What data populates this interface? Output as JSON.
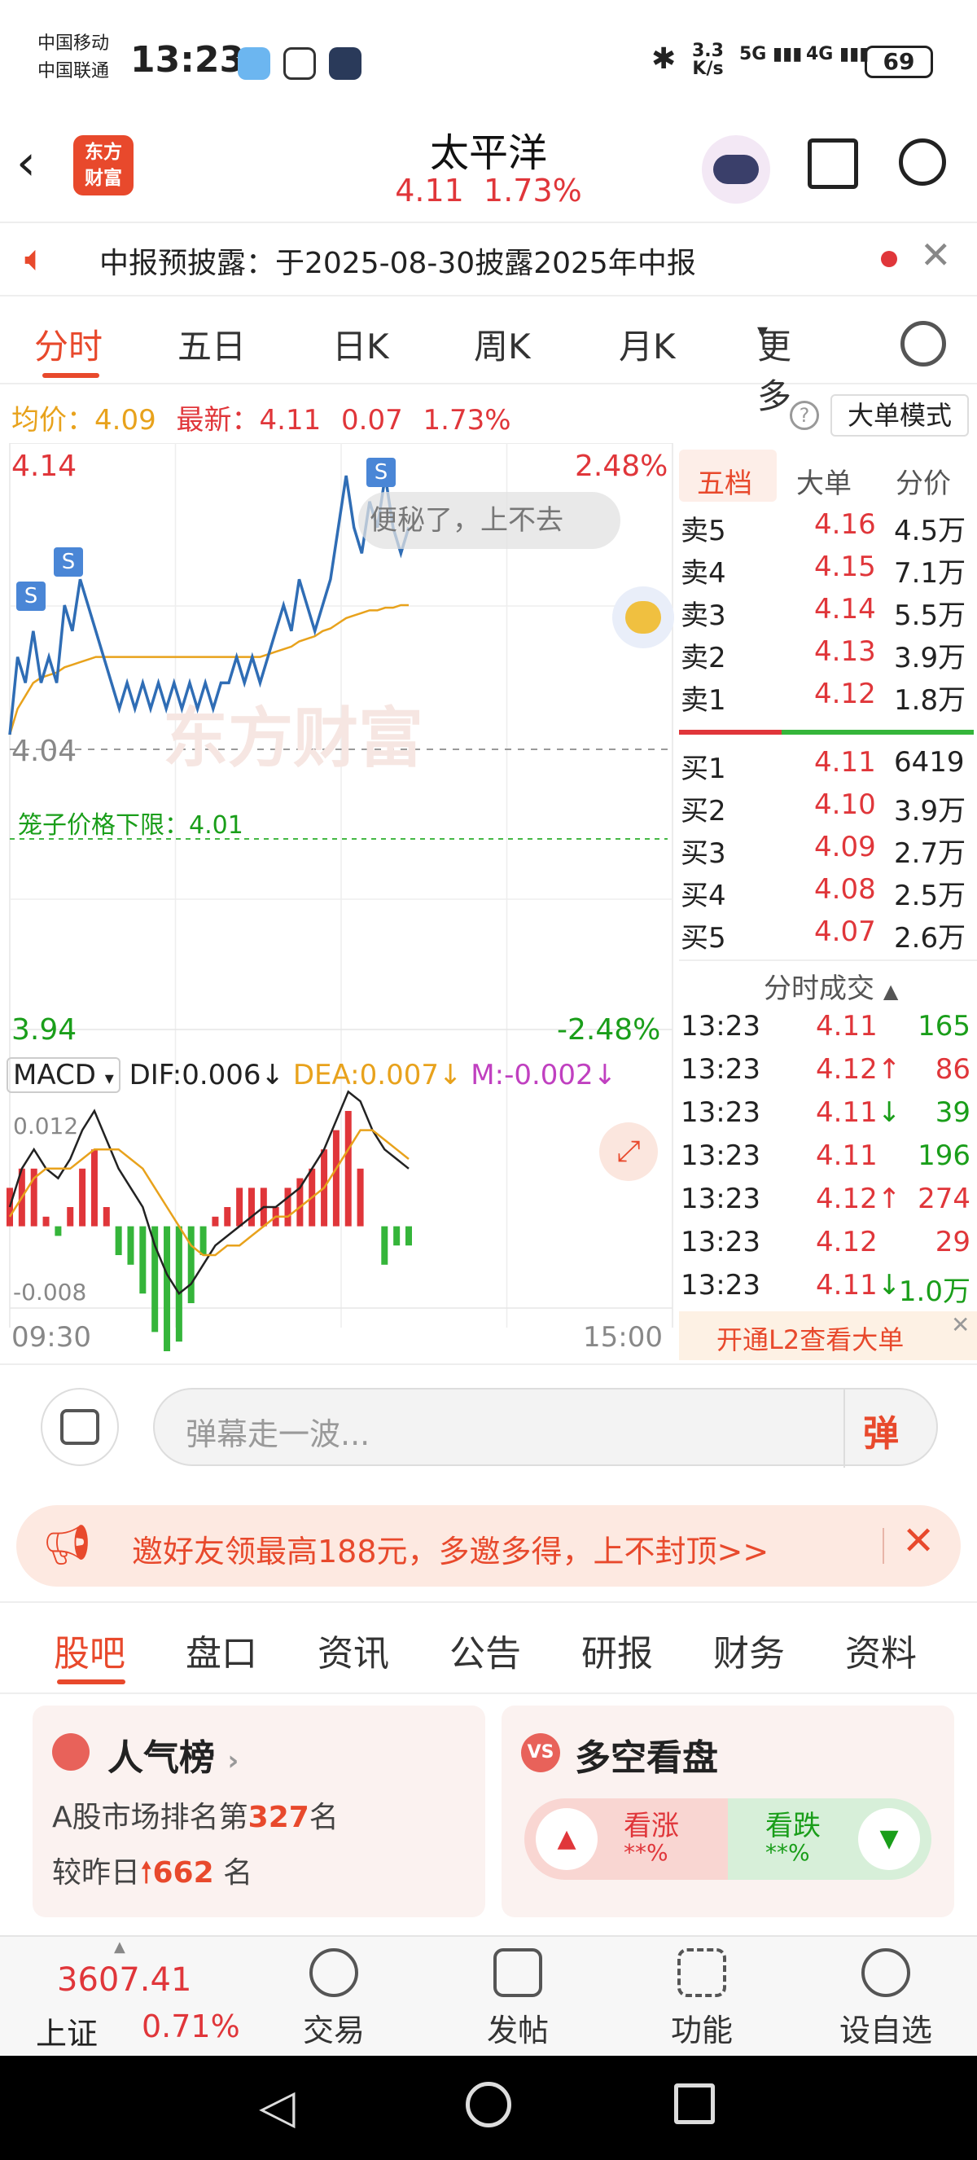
{
  "status": {
    "carrier1": "中国移动",
    "carrier2": "中国联通",
    "time": "13:23",
    "net_speed_top": "3.3",
    "net_speed_unit": "K/s",
    "net_5g": "5G",
    "net_4g": "4G",
    "battery": "69"
  },
  "header": {
    "brand_line1": "东方",
    "brand_line2": "财富",
    "stock_name": "太平洋",
    "stock_price": "4.11",
    "stock_change": "1.73%"
  },
  "notice": {
    "text": "中报预披露：于2025-08-30披露2025年中报"
  },
  "chart_tabs": [
    "分时",
    "五日",
    "日K",
    "周K",
    "月K",
    "更多"
  ],
  "summary": {
    "avg_label": "均价：",
    "avg_value": "4.09",
    "latest_label": "最新：",
    "latest_value": "4.11",
    "change_value": "0.07",
    "change_pct": "1.73%",
    "mode_button": "大单模式"
  },
  "chart_data": {
    "type": "line",
    "y_top": "4.14",
    "y_top_pct": "2.48%",
    "y_mid": "4.04",
    "y_bottom": "3.94",
    "y_bottom_pct": "-2.48%",
    "limit_label": "笼子价格下限：",
    "limit_value": "4.01",
    "x_start": "09:30",
    "x_end": "15:00",
    "watermark": "东方财富",
    "danmaku": "便秘了，上不去",
    "ylim": [
      3.94,
      4.14
    ],
    "price_series": [
      4.04,
      4.07,
      4.06,
      4.08,
      4.06,
      4.07,
      4.06,
      4.09,
      4.08,
      4.1,
      4.09,
      4.08,
      4.07,
      4.06,
      4.05,
      4.06,
      4.05,
      4.06,
      4.05,
      4.06,
      4.05,
      4.06,
      4.05,
      4.06,
      4.05,
      4.06,
      4.05,
      4.06,
      4.06,
      4.07,
      4.06,
      4.07,
      4.06,
      4.07,
      4.08,
      4.09,
      4.08,
      4.1,
      4.09,
      4.08,
      4.09,
      4.1,
      4.12,
      4.14,
      4.12,
      4.11,
      4.13,
      4.12,
      4.14,
      4.12,
      4.11,
      4.12
    ],
    "avg_series": [
      4.04,
      4.05,
      4.055,
      4.06,
      4.062,
      4.063,
      4.064,
      4.066,
      4.067,
      4.068,
      4.069,
      4.07,
      4.07,
      4.07,
      4.07,
      4.07,
      4.07,
      4.07,
      4.07,
      4.07,
      4.07,
      4.07,
      4.07,
      4.07,
      4.07,
      4.07,
      4.07,
      4.07,
      4.07,
      4.07,
      4.07,
      4.07,
      4.07,
      4.071,
      4.072,
      4.073,
      4.074,
      4.076,
      4.077,
      4.078,
      4.08,
      4.081,
      4.083,
      4.085,
      4.086,
      4.087,
      4.088,
      4.088,
      4.089,
      4.089,
      4.09,
      4.09
    ],
    "macd": {
      "label": "MACD",
      "dif_label": "DIF:",
      "dif": "0.006",
      "dea_label": "DEA:",
      "dea": "0.007",
      "m_label": "M:",
      "m": "-0.002",
      "top": "0.012",
      "bottom": "-0.008",
      "ylim": [
        -0.008,
        0.012
      ],
      "dif_series": [
        0.002,
        0.006,
        0.008,
        0.006,
        0.005,
        0.007,
        0.01,
        0.012,
        0.009,
        0.006,
        0.004,
        0.002,
        -0.002,
        -0.005,
        -0.007,
        -0.006,
        -0.004,
        -0.002,
        -0.001,
        0,
        0.001,
        0.002,
        0.002,
        0.003,
        0.004,
        0.006,
        0.008,
        0.011,
        0.014,
        0.013,
        0.01,
        0.008,
        0.007,
        0.006
      ],
      "dea_series": [
        0.001,
        0.003,
        0.005,
        0.006,
        0.006,
        0.006,
        0.007,
        0.008,
        0.008,
        0.008,
        0.007,
        0.006,
        0.004,
        0.002,
        0,
        -0.002,
        -0.003,
        -0.003,
        -0.002,
        -0.002,
        -0.001,
        0,
        0.001,
        0.001,
        0.002,
        0.003,
        0.004,
        0.006,
        0.008,
        0.01,
        0.01,
        0.009,
        0.008,
        0.007
      ],
      "hist": [
        0.004,
        0.006,
        0.006,
        0.001,
        -0.001,
        0.002,
        0.006,
        0.008,
        0.002,
        -0.003,
        -0.004,
        -0.007,
        -0.011,
        -0.013,
        -0.012,
        -0.008,
        -0.003,
        0.001,
        0.002,
        0.004,
        0.004,
        0.004,
        0.002,
        0.004,
        0.005,
        0.006,
        0.008,
        0.01,
        0.012,
        0.006,
        0,
        -0.004,
        -0.002,
        -0.002
      ]
    }
  },
  "orderbook": {
    "tabs": [
      "五档",
      "大单",
      "分价"
    ],
    "sells": [
      {
        "label": "卖5",
        "price": "4.16",
        "vol": "4.5万"
      },
      {
        "label": "卖4",
        "price": "4.15",
        "vol": "7.1万"
      },
      {
        "label": "卖3",
        "price": "4.14",
        "vol": "5.5万"
      },
      {
        "label": "卖2",
        "price": "4.13",
        "vol": "3.9万"
      },
      {
        "label": "卖1",
        "price": "4.12",
        "vol": "1.8万"
      }
    ],
    "buys": [
      {
        "label": "买1",
        "price": "4.11",
        "vol": "6419"
      },
      {
        "label": "买2",
        "price": "4.10",
        "vol": "3.9万"
      },
      {
        "label": "买3",
        "price": "4.09",
        "vol": "2.7万"
      },
      {
        "label": "买4",
        "price": "4.08",
        "vol": "2.5万"
      },
      {
        "label": "买5",
        "price": "4.07",
        "vol": "2.6万"
      }
    ],
    "trades_title": "分时成交",
    "trades": [
      {
        "time": "13:23",
        "price": "4.11",
        "arrow": "",
        "vol": "165",
        "dir": "green"
      },
      {
        "time": "13:23",
        "price": "4.12",
        "arrow": "↑",
        "vol": "86",
        "dir": "red"
      },
      {
        "time": "13:23",
        "price": "4.11",
        "arrow": "↓",
        "vol": "39",
        "dir": "green"
      },
      {
        "time": "13:23",
        "price": "4.11",
        "arrow": "",
        "vol": "196",
        "dir": "green"
      },
      {
        "time": "13:23",
        "price": "4.12",
        "arrow": "↑",
        "vol": "274",
        "dir": "red"
      },
      {
        "time": "13:23",
        "price": "4.12",
        "arrow": "",
        "vol": "29",
        "dir": "red"
      },
      {
        "time": "13:23",
        "price": "4.11",
        "arrow": "↓",
        "vol": "1.0万",
        "dir": "green"
      }
    ],
    "l2_banner": "开通L2查看大单"
  },
  "comment": {
    "placeholder": "弹幕走一波...",
    "danmu_button": "弹"
  },
  "promo": {
    "text": "邀好友领最高188元，多邀多得，上不封顶>>"
  },
  "section_tabs": [
    "股吧",
    "盘口",
    "资讯",
    "公告",
    "研报",
    "财务",
    "资料"
  ],
  "popularity": {
    "title": "人气榜",
    "rank_prefix": "A股市场排名第",
    "rank": "327",
    "rank_suffix": "名",
    "change_prefix": "较昨日",
    "change_value": "662",
    "change_suffix": "名"
  },
  "bullbear": {
    "title": "多空看盘",
    "bull_label": "看涨",
    "bull_value": "**%",
    "bear_label": "看跌",
    "bear_value": "**%"
  },
  "bottom_nav": {
    "index_value": "3607.41",
    "index_name": "上证",
    "index_change": "0.71%",
    "items": [
      "交易",
      "发帖",
      "功能",
      "设自选"
    ]
  },
  "colors": {
    "accent": "#e8492c",
    "up": "#e0363a",
    "down": "#1a9e1a",
    "price_line": "#2f6db5",
    "avg_line": "#e8a21c"
  }
}
